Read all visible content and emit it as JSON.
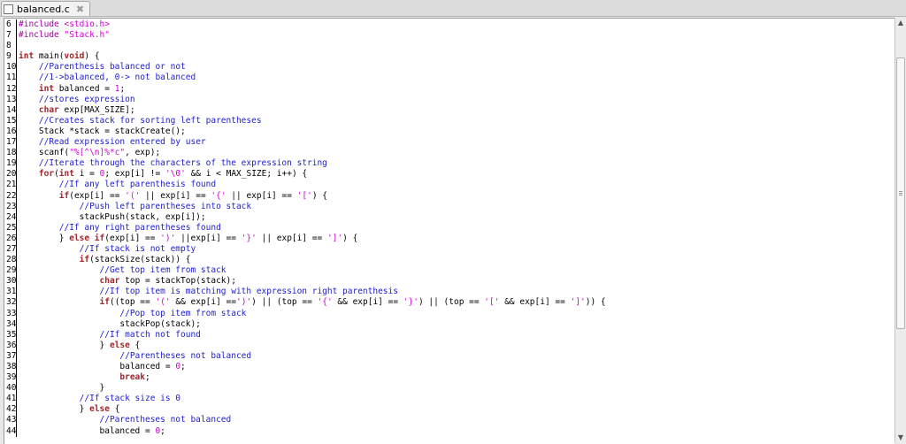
{
  "tab": {
    "title": "balanced.c",
    "close_glyph": "✖"
  },
  "lines": [
    {
      "n": "6",
      "tokens": [
        {
          "c": "pp",
          "t": "#include "
        },
        {
          "c": "str",
          "t": "<stdio.h>"
        }
      ]
    },
    {
      "n": "7",
      "tokens": [
        {
          "c": "pp",
          "t": "#include "
        },
        {
          "c": "str",
          "t": "\"Stack.h\""
        }
      ]
    },
    {
      "n": "8",
      "tokens": []
    },
    {
      "n": "9",
      "tokens": [
        {
          "c": "kw",
          "t": "int"
        },
        {
          "c": "",
          "t": " main("
        },
        {
          "c": "kw",
          "t": "void"
        },
        {
          "c": "",
          "t": ") {"
        }
      ]
    },
    {
      "n": "10",
      "tokens": [
        {
          "c": "",
          "t": "    "
        },
        {
          "c": "cm",
          "t": "//Parenthesis balanced or not"
        }
      ]
    },
    {
      "n": "11",
      "tokens": [
        {
          "c": "",
          "t": "    "
        },
        {
          "c": "cm",
          "t": "//1->balanced, 0-> not balanced"
        }
      ]
    },
    {
      "n": "12",
      "tokens": [
        {
          "c": "",
          "t": "    "
        },
        {
          "c": "kw",
          "t": "int"
        },
        {
          "c": "",
          "t": " balanced = "
        },
        {
          "c": "str",
          "t": "1"
        },
        {
          "c": "",
          "t": ";"
        }
      ]
    },
    {
      "n": "13",
      "tokens": [
        {
          "c": "",
          "t": "    "
        },
        {
          "c": "cm",
          "t": "//stores expression"
        }
      ]
    },
    {
      "n": "14",
      "tokens": [
        {
          "c": "",
          "t": "    "
        },
        {
          "c": "kw",
          "t": "char"
        },
        {
          "c": "",
          "t": " exp[MAX_SIZE];"
        }
      ]
    },
    {
      "n": "15",
      "tokens": [
        {
          "c": "",
          "t": "    "
        },
        {
          "c": "cm",
          "t": "//Creates stack for sorting left parentheses"
        }
      ]
    },
    {
      "n": "16",
      "tokens": [
        {
          "c": "",
          "t": "    Stack *stack = stackCreate();"
        }
      ]
    },
    {
      "n": "17",
      "tokens": [
        {
          "c": "",
          "t": "    "
        },
        {
          "c": "cm",
          "t": "//Read expression entered by user"
        }
      ]
    },
    {
      "n": "18",
      "tokens": [
        {
          "c": "",
          "t": "    scanf("
        },
        {
          "c": "str",
          "t": "\"%[^\\n]%*c\""
        },
        {
          "c": "",
          "t": ", exp);"
        }
      ]
    },
    {
      "n": "19",
      "tokens": [
        {
          "c": "",
          "t": "    "
        },
        {
          "c": "cm",
          "t": "//Iterate through the characters of the expression string"
        }
      ]
    },
    {
      "n": "20",
      "tokens": [
        {
          "c": "",
          "t": "    "
        },
        {
          "c": "kw",
          "t": "for"
        },
        {
          "c": "",
          "t": "("
        },
        {
          "c": "kw",
          "t": "int"
        },
        {
          "c": "",
          "t": " i = "
        },
        {
          "c": "str",
          "t": "0"
        },
        {
          "c": "",
          "t": "; exp[i] != "
        },
        {
          "c": "str",
          "t": "'\\0'"
        },
        {
          "c": "",
          "t": " && i < MAX_SIZE; i++) {"
        }
      ]
    },
    {
      "n": "21",
      "tokens": [
        {
          "c": "",
          "t": "        "
        },
        {
          "c": "cm",
          "t": "//If any left parenthesis found"
        }
      ]
    },
    {
      "n": "22",
      "tokens": [
        {
          "c": "",
          "t": "        "
        },
        {
          "c": "kw",
          "t": "if"
        },
        {
          "c": "",
          "t": "(exp[i] == "
        },
        {
          "c": "str",
          "t": "'('"
        },
        {
          "c": "",
          "t": " || exp[i] == "
        },
        {
          "c": "str",
          "t": "'{'"
        },
        {
          "c": "",
          "t": " || exp[i] == "
        },
        {
          "c": "str",
          "t": "'['"
        },
        {
          "c": "",
          "t": ") {"
        }
      ]
    },
    {
      "n": "23",
      "tokens": [
        {
          "c": "",
          "t": "            "
        },
        {
          "c": "cm",
          "t": "//Push left parentheses into stack"
        }
      ]
    },
    {
      "n": "24",
      "tokens": [
        {
          "c": "",
          "t": "            stackPush(stack, exp[i]);"
        }
      ]
    },
    {
      "n": "25",
      "tokens": [
        {
          "c": "",
          "t": "        "
        },
        {
          "c": "cm",
          "t": "//If any right parentheses found"
        }
      ]
    },
    {
      "n": "26",
      "tokens": [
        {
          "c": "",
          "t": "        } "
        },
        {
          "c": "kw",
          "t": "else if"
        },
        {
          "c": "",
          "t": "(exp[i] == "
        },
        {
          "c": "str",
          "t": "')'"
        },
        {
          "c": "",
          "t": " ||exp[i] == "
        },
        {
          "c": "str",
          "t": "'}'"
        },
        {
          "c": "",
          "t": " || exp[i] == "
        },
        {
          "c": "str",
          "t": "']'"
        },
        {
          "c": "",
          "t": ") {"
        }
      ]
    },
    {
      "n": "27",
      "tokens": [
        {
          "c": "",
          "t": "            "
        },
        {
          "c": "cm",
          "t": "//If stack is not empty"
        }
      ]
    },
    {
      "n": "28",
      "tokens": [
        {
          "c": "",
          "t": "            "
        },
        {
          "c": "kw",
          "t": "if"
        },
        {
          "c": "",
          "t": "(stackSize(stack)) {"
        }
      ]
    },
    {
      "n": "29",
      "tokens": [
        {
          "c": "",
          "t": "                "
        },
        {
          "c": "cm",
          "t": "//Get top item from stack"
        }
      ]
    },
    {
      "n": "30",
      "tokens": [
        {
          "c": "",
          "t": "                "
        },
        {
          "c": "kw",
          "t": "char"
        },
        {
          "c": "",
          "t": " top = stackTop(stack);"
        }
      ]
    },
    {
      "n": "31",
      "tokens": [
        {
          "c": "",
          "t": "                "
        },
        {
          "c": "cm",
          "t": "//If top item is matching with expression right parenthesis"
        }
      ]
    },
    {
      "n": "32",
      "tokens": [
        {
          "c": "",
          "t": "                "
        },
        {
          "c": "kw",
          "t": "if"
        },
        {
          "c": "",
          "t": "((top == "
        },
        {
          "c": "str",
          "t": "'('"
        },
        {
          "c": "",
          "t": " && exp[i] =="
        },
        {
          "c": "str",
          "t": "')'"
        },
        {
          "c": "",
          "t": ") || (top == "
        },
        {
          "c": "str",
          "t": "'{'"
        },
        {
          "c": "",
          "t": " && exp[i] == "
        },
        {
          "c": "str",
          "t": "'}'"
        },
        {
          "c": "",
          "t": ") || (top == "
        },
        {
          "c": "str",
          "t": "'['"
        },
        {
          "c": "",
          "t": " && exp[i] == "
        },
        {
          "c": "str",
          "t": "']'"
        },
        {
          "c": "",
          "t": ")) {"
        }
      ]
    },
    {
      "n": "33",
      "tokens": [
        {
          "c": "",
          "t": "                    "
        },
        {
          "c": "cm",
          "t": "//Pop top item from stack"
        }
      ]
    },
    {
      "n": "34",
      "tokens": [
        {
          "c": "",
          "t": "                    stackPop(stack);"
        }
      ]
    },
    {
      "n": "35",
      "tokens": [
        {
          "c": "",
          "t": "                "
        },
        {
          "c": "cm",
          "t": "//If match not found"
        }
      ]
    },
    {
      "n": "36",
      "tokens": [
        {
          "c": "",
          "t": "                } "
        },
        {
          "c": "kw",
          "t": "else"
        },
        {
          "c": "",
          "t": " {"
        }
      ]
    },
    {
      "n": "37",
      "tokens": [
        {
          "c": "",
          "t": "                    "
        },
        {
          "c": "cm",
          "t": "//Parentheses not balanced"
        }
      ]
    },
    {
      "n": "38",
      "tokens": [
        {
          "c": "",
          "t": "                    balanced = "
        },
        {
          "c": "str",
          "t": "0"
        },
        {
          "c": "",
          "t": ";"
        }
      ]
    },
    {
      "n": "39",
      "tokens": [
        {
          "c": "",
          "t": "                    "
        },
        {
          "c": "kw",
          "t": "break"
        },
        {
          "c": "",
          "t": ";"
        }
      ]
    },
    {
      "n": "40",
      "tokens": [
        {
          "c": "",
          "t": "                }"
        }
      ]
    },
    {
      "n": "41",
      "tokens": [
        {
          "c": "",
          "t": "            "
        },
        {
          "c": "cm",
          "t": "//If stack size is 0"
        }
      ]
    },
    {
      "n": "42",
      "tokens": [
        {
          "c": "",
          "t": "            } "
        },
        {
          "c": "kw",
          "t": "else"
        },
        {
          "c": "",
          "t": " {"
        }
      ]
    },
    {
      "n": "43",
      "tokens": [
        {
          "c": "",
          "t": "                "
        },
        {
          "c": "cm",
          "t": "//Parentheses not balanced"
        }
      ]
    },
    {
      "n": "44",
      "tokens": [
        {
          "c": "",
          "t": "                balanced = "
        },
        {
          "c": "str",
          "t": "0"
        },
        {
          "c": "",
          "t": ";"
        }
      ]
    }
  ]
}
